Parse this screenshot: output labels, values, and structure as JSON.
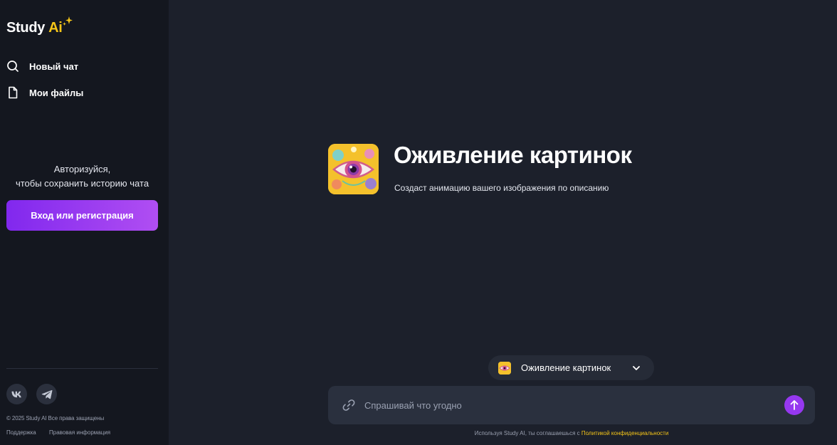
{
  "brand": {
    "name": "Study",
    "ai": "Ai"
  },
  "sidebar": {
    "items": [
      {
        "label": "Новый чат",
        "icon": "search-icon"
      },
      {
        "label": "Мои файлы",
        "icon": "file-icon"
      }
    ],
    "auth_text_line1": "Авторизуйся,",
    "auth_text_line2": "чтобы сохранить историю чата",
    "login_button": "Вход или регистрация",
    "social": [
      {
        "icon": "vk-icon"
      },
      {
        "icon": "telegram-icon"
      }
    ],
    "copyright": "© 2025 Study AI Все права защищены",
    "footer_links": [
      "Поддержка",
      "Правовая информация"
    ]
  },
  "main": {
    "tool_title": "Оживление картинок",
    "tool_subtitle": "Создаст анимацию вашего изображения по описанию",
    "tool_selector_label": "Оживление картинок",
    "input_placeholder": "Спрашивай что угодно",
    "disclaimer_text": "Используя Study AI, ты соглашаешься с ",
    "disclaimer_link": "Политикой конфиденциальности"
  },
  "colors": {
    "background": "#1c202b",
    "sidebar": "#14171f",
    "accent_purple": "#9638f0",
    "accent_yellow": "#f5c518"
  }
}
